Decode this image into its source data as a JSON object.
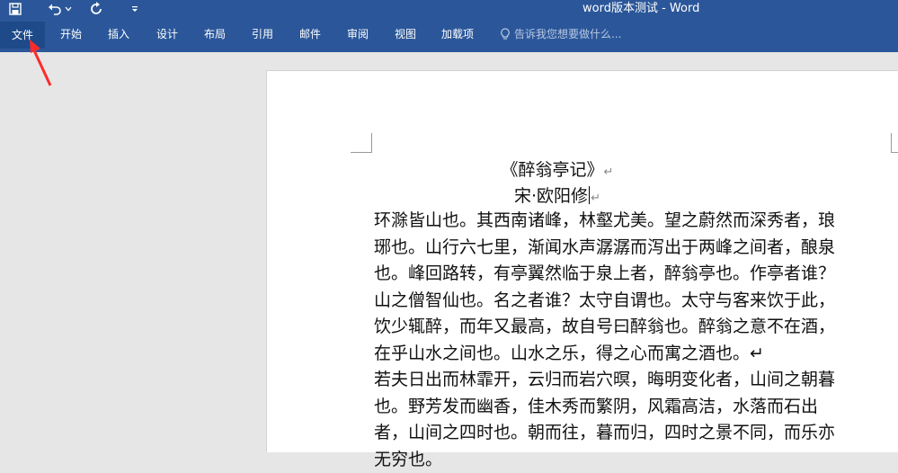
{
  "window": {
    "title": "word版本测试 - Word"
  },
  "qat": {
    "save_icon": "save-icon",
    "undo_icon": "undo-icon",
    "undo_dropdown": "chevron-down-icon",
    "redo_icon": "redo-icon",
    "customize_icon": "customize-qat-icon"
  },
  "ribbon": {
    "tabs": [
      {
        "label": "文件"
      },
      {
        "label": "开始"
      },
      {
        "label": "插入"
      },
      {
        "label": "设计"
      },
      {
        "label": "布局"
      },
      {
        "label": "引用"
      },
      {
        "label": "邮件"
      },
      {
        "label": "审阅"
      },
      {
        "label": "视图"
      },
      {
        "label": "加载项"
      }
    ],
    "tellme_placeholder": "告诉我您想要做什么..."
  },
  "document": {
    "title": "《醉翁亭记》",
    "author": "宋·欧阳修",
    "para_mark": "↵",
    "lines": [
      "环滁皆山也。其西南诸峰，林壑尤美。望之蔚然而深秀者，琅",
      "琊也。山行六七里，渐闻水声潺潺而泻出于两峰之间者，酿泉",
      "也。峰回路转，有亭翼然临于泉上者，醉翁亭也。作亭者谁？",
      "山之僧智仙也。名之者谁？太守自谓也。太守与客来饮于此，",
      "饮少辄醉，而年又最高，故自号曰醉翁也。醉翁之意不在酒，",
      "在乎山水之间也。山水之乐，得之心而寓之酒也。↵",
      "若夫日出而林霏开，云归而岩穴暝，晦明变化者，山间之朝暮",
      "也。野芳发而幽香，佳木秀而繁阴，风霜高洁，水落而石出",
      "者，山间之四时也。朝而往，暮而归，四时之景不同，而乐亦",
      "无穷也。"
    ]
  },
  "annotation": {
    "arrow_color": "#ff2a2a"
  },
  "colors": {
    "ribbon": "#2b579a",
    "active_tab": "#1e4a8a",
    "background": "#e6e6e6",
    "page": "#ffffff"
  }
}
